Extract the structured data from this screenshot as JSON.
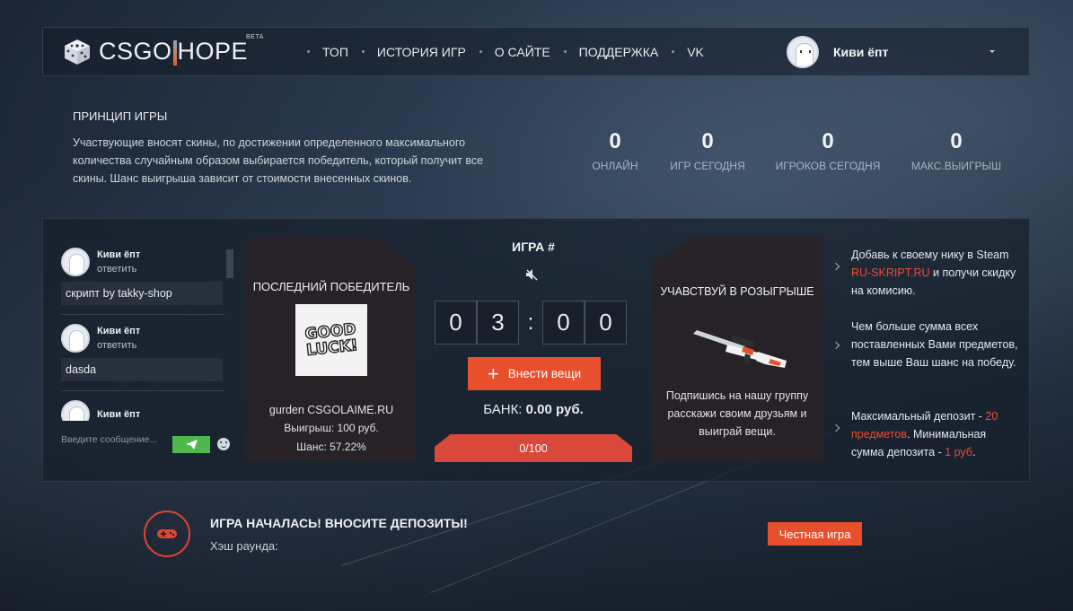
{
  "header": {
    "logo_text_left": "CSGO",
    "logo_text_right": "HOPE",
    "logo_badge": "BETA",
    "nav": [
      {
        "label": "ТОП"
      },
      {
        "label": "ИСТОРИЯ ИГР"
      },
      {
        "label": "О САЙТЕ"
      },
      {
        "label": "ПОДДЕРЖКА"
      },
      {
        "label": "VK"
      }
    ],
    "user_name": "Киви ёпт"
  },
  "principle": {
    "title": "ПРИНЦИП ИГРЫ",
    "text": "Участвующие вносят скины, по достижении определенного максимального количества случайным образом выбирается победитель, который получит все скины. Шанс выигрыша зависит от стоимости внесенных скинов."
  },
  "stats": [
    {
      "value": "0",
      "label": "ОНЛАЙН"
    },
    {
      "value": "0",
      "label": "ИГР СЕГОДНЯ"
    },
    {
      "value": "0",
      "label": "ИГРОКОВ СЕГОДНЯ"
    },
    {
      "value": "0",
      "label": "МАКС.ВЫИГРЫШ"
    }
  ],
  "chat": {
    "messages": [
      {
        "name": "Киви ёпт",
        "reply": "ответить",
        "text": "скрипт by takky-shop"
      },
      {
        "name": "Киви ёпт",
        "reply": "ответить",
        "text": "dasda"
      },
      {
        "name": "Киви ёпт",
        "reply": "",
        "text": ""
      }
    ],
    "input_placeholder": "Введите сообщение..."
  },
  "last_winner": {
    "title": "ПОСЛЕДНИЙ ПОБЕДИТЕЛЬ",
    "avatar_text": "GOOD LUCK!",
    "name": "gurden CSGOLAIME.RU",
    "win": "Выигрыш: 100 руб.",
    "chance": "Шанс: 57.22%"
  },
  "game": {
    "title": "ИГРА #",
    "timer": [
      "0",
      "3",
      "0",
      "0"
    ],
    "timer_sep": ":",
    "deposit_label": "Внести вещи",
    "bank_label": "БАНК:",
    "bank_value": "0.00 руб.",
    "progress_text": "0/100",
    "progress_fraction": 0.0
  },
  "giveaway": {
    "title": "УЧАВСТВУЙ В РОЗЫГРЫШЕ",
    "text": "Подпишись на нашу группу расскажи своим друзьям и выиграй вещи."
  },
  "info": [
    {
      "parts": [
        {
          "t": "Добавь к своему нику в Steam ",
          "hl": false
        },
        {
          "t": "RU-SKRIPT.RU",
          "hl": true
        },
        {
          "t": " и получи скидку на комисию.",
          "hl": false
        }
      ]
    },
    {
      "parts": [
        {
          "t": "Чем больше сумма всех поставленных Вами предметов, тем выше Ваш шанс на победу.",
          "hl": false
        }
      ]
    },
    {
      "parts": [
        {
          "t": "Максимальный депозит - ",
          "hl": false
        },
        {
          "t": "20 предметов",
          "hl": true
        },
        {
          "t": ". Минимальная сумма депозита - ",
          "hl": false
        },
        {
          "t": "1 руб",
          "hl": true
        },
        {
          "t": ".",
          "hl": false
        }
      ]
    }
  ],
  "round": {
    "title": "ИГРА НАЧАЛАСЬ! ВНОСИТЕ ДЕПОЗИТЫ!",
    "hash_label": "Хэш раунда:",
    "fair_label": "Честная игра"
  },
  "colors": {
    "accent": "#e8502d",
    "highlight": "#ee4a37",
    "send": "#4fb84c"
  }
}
